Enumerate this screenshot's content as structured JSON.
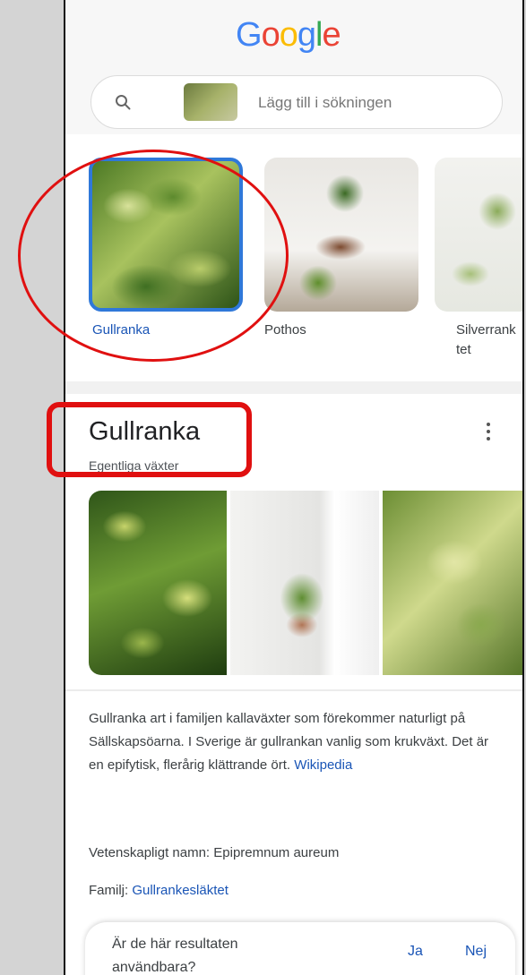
{
  "header": {
    "logo_letters": [
      {
        "char": "G",
        "color": "#4285f4"
      },
      {
        "char": "o",
        "color": "#ea4335"
      },
      {
        "char": "o",
        "color": "#fbbc05"
      },
      {
        "char": "g",
        "color": "#4285f4"
      },
      {
        "char": "l",
        "color": "#34a853"
      },
      {
        "char": "e",
        "color": "#ea4335"
      }
    ],
    "search_placeholder": "Lägg till i sökningen",
    "search_icon": "search-icon"
  },
  "carousel": {
    "items": [
      {
        "label": "Gullranka",
        "selected": true
      },
      {
        "label": "Pothos",
        "selected": false
      },
      {
        "label": "Silverrank",
        "label_line2": "tet",
        "selected": false
      }
    ]
  },
  "knowledge_panel": {
    "title": "Gullranka",
    "subtitle": "Egentliga växter",
    "more_icon": "more-vert-icon",
    "description": "Gullranka art i familjen kallaväxter som förekommer naturligt på Sällskapsöarna. I Sverige är gullrankan vanlig som krukväxt. Det är en epifytisk, flerårig klättrande ört.",
    "source_link": "Wikipedia",
    "facts": [
      {
        "label": "Vetenskapligt namn:",
        "value": "Epipremnum aureum"
      },
      {
        "label": "Familj:",
        "value": "Gullrankesläktet"
      }
    ]
  },
  "feedback": {
    "question": "Är de här resultaten användbara?",
    "yes": "Ja",
    "no": "Nej"
  },
  "colors": {
    "accent": "#2f78d9",
    "link": "#1a55b6",
    "annotation": "#e01010"
  }
}
